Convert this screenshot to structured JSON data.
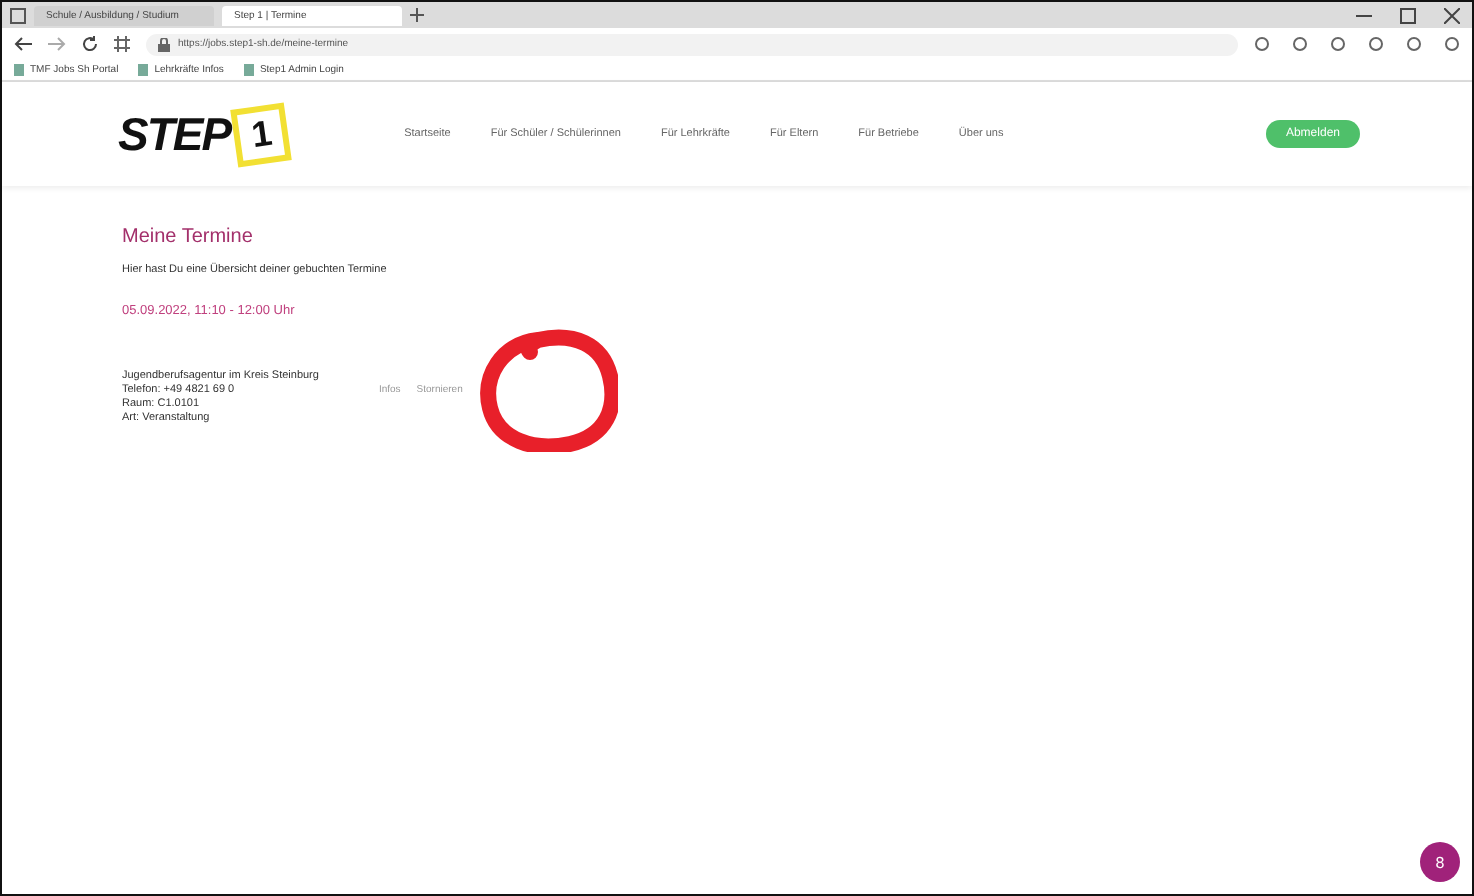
{
  "browser": {
    "tabs": [
      {
        "title": "Schule / Ausbildung / Studium",
        "selected": false
      },
      {
        "title": "Step 1 | Termine",
        "selected": true
      }
    ],
    "url": "https://jobs.step1-sh.de/meine-termine",
    "bookmarks": [
      "TMF Jobs Sh Portal",
      "Lehrkräfte Infos",
      "Step1 Admin Login"
    ]
  },
  "site": {
    "logo": "STEP",
    "logo_number": "1",
    "nav": [
      "Startseite",
      "Für Schüler / Schülerinnen",
      "Für Lehrkräfte",
      "Für Eltern",
      "Für Betriebe",
      "Über uns"
    ],
    "account_button": "Abmelden"
  },
  "page": {
    "title": "Meine Termine",
    "intro": "Hier hast Du eine Übersicht deiner gebuchten Termine",
    "appointments": [
      {
        "time": "05.09.2022, 11:10 - 12:00 Uhr",
        "lines": [
          "Jugendberufsagentur im Kreis Steinburg",
          "Telefon: +49 4821 69 0",
          "Raum: C1.0101",
          "Art: Veranstaltung"
        ],
        "actions": [
          "Infos",
          "Stornieren"
        ]
      }
    ]
  },
  "annotation": {
    "kind": "circle"
  },
  "chat_button": "8"
}
